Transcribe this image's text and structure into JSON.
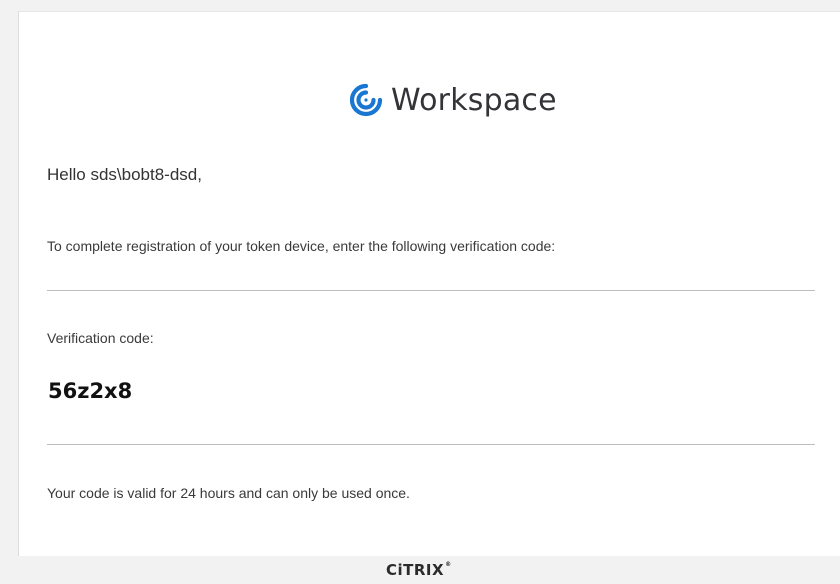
{
  "brand": {
    "icon": "citrix-workspace-icon",
    "name": "Workspace",
    "accent_color": "#1976d2"
  },
  "email": {
    "greeting": "Hello sds\\bobt8-dsd,",
    "intro": "To complete registration of your token device, enter the following verification code:",
    "code_label": "Verification code:",
    "code_value": "56z2x8",
    "validity_note": "Your code is valid for 24 hours and can only be used once."
  },
  "footer": {
    "logo_text": "CiTRIX",
    "trademark": "®"
  }
}
